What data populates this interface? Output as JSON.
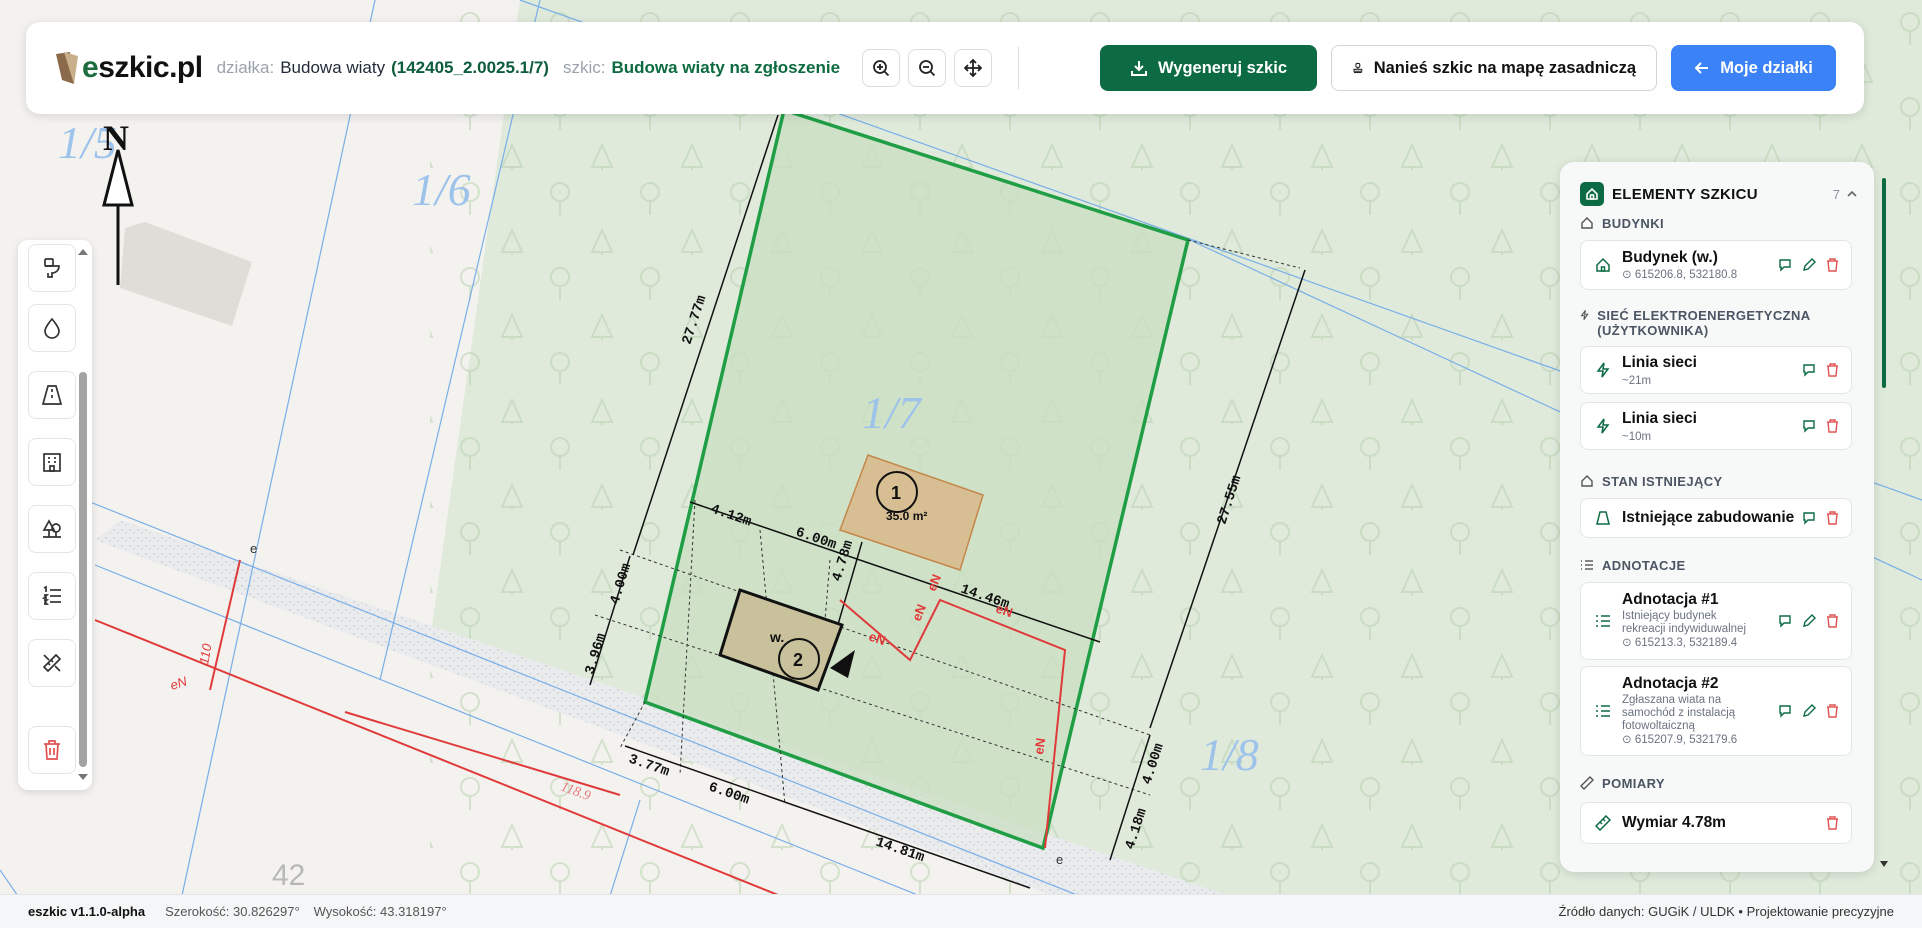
{
  "header": {
    "logo_text": "szkic.pl",
    "logo_e": "e",
    "dzialka_label": "działka:",
    "dzialka_name": "Budowa wiaty",
    "dzialka_id": "(142405_2.0025.1/7)",
    "szkic_label": "szkic:",
    "szkic_name": "Budowa wiaty na zgłoszenie",
    "generate_label": "Wygeneruj szkic",
    "apply_map_label": "Nanieś szkic na mapę zasadniczą",
    "my_plots_label": "Moje działki",
    "tools": [
      "zoom-in-icon",
      "zoom-out-icon",
      "move-icon"
    ]
  },
  "map": {
    "north_label": "N",
    "parcel_labels": [
      "1/5",
      "1/6",
      "1/7",
      "1/8",
      "42",
      "118.9"
    ],
    "building_1_number": "1",
    "building_1_area": "35.0 m²",
    "building_2_number": "2",
    "building_2_label": "w.",
    "dimensions": [
      "27.77m",
      "27.55m",
      "4.12m",
      "6.00m",
      "14.46m",
      "4.78m",
      "4.00m",
      "3.96m",
      "3.77m",
      "6.00m",
      "14.81m",
      "4.00m",
      "4.18m"
    ],
    "line_labels": [
      "eN",
      "eN",
      "eN",
      "eN",
      "eN",
      "eN"
    ],
    "small_labels": [
      "e",
      "e",
      "110",
      "eN"
    ],
    "colors": {
      "parcel_border": "#1f9e45",
      "parcel_fill": "#cfe3c6",
      "power_line": "#e03a3a",
      "building_1": "#d8b98a",
      "building_2": "#c8c19b"
    }
  },
  "left_tools": [
    "toilet-icon",
    "drop-icon",
    "road-icon",
    "building-icon",
    "trees-icon",
    "list-numbered-icon",
    "ruler-pencil-icon",
    "trash-icon"
  ],
  "panel": {
    "title": "ELEMENTY SZKICU",
    "count": "7",
    "sections": {
      "budynki": "BUDYNKI",
      "siec": "SIEĆ ELEKTROENERGETYCZNA (UŻYTKOWNIKA)",
      "stan": "STAN ISTNIEJĄCY",
      "adnotacje": "ADNOTACJE",
      "pomiary": "POMIARY"
    },
    "items": [
      {
        "title": "Budynek (w.)",
        "sub": "615206.8, 532180.8"
      },
      {
        "title": "Linia sieci",
        "sub": "~21m"
      },
      {
        "title": "Linia sieci",
        "sub": "~10m"
      },
      {
        "title": "Istniejące zabudowanie",
        "sub": ""
      },
      {
        "title": "Adnotacja #1",
        "sub1": "Istniejący budynek",
        "sub2": "rekreacji indywiduwalnej",
        "sub3": "615213.3, 532189.4"
      },
      {
        "title": "Adnotacja #2",
        "sub1": "Zgłaszana wiata na",
        "sub2": "samochód z instalacją",
        "sub3": "fotowoltaiczną",
        "sub4": "615207.9, 532179.6"
      },
      {
        "title": "Wymiar 4.78m",
        "sub": ""
      }
    ]
  },
  "status": {
    "version": "eszkic v1.1.0-alpha",
    "lon": "Szerokość: 30.826297°",
    "lat": "Wysokość: 43.318197°",
    "source": "Źródło danych: GUGiK / ULDK • Projektowanie precyzyjne"
  }
}
